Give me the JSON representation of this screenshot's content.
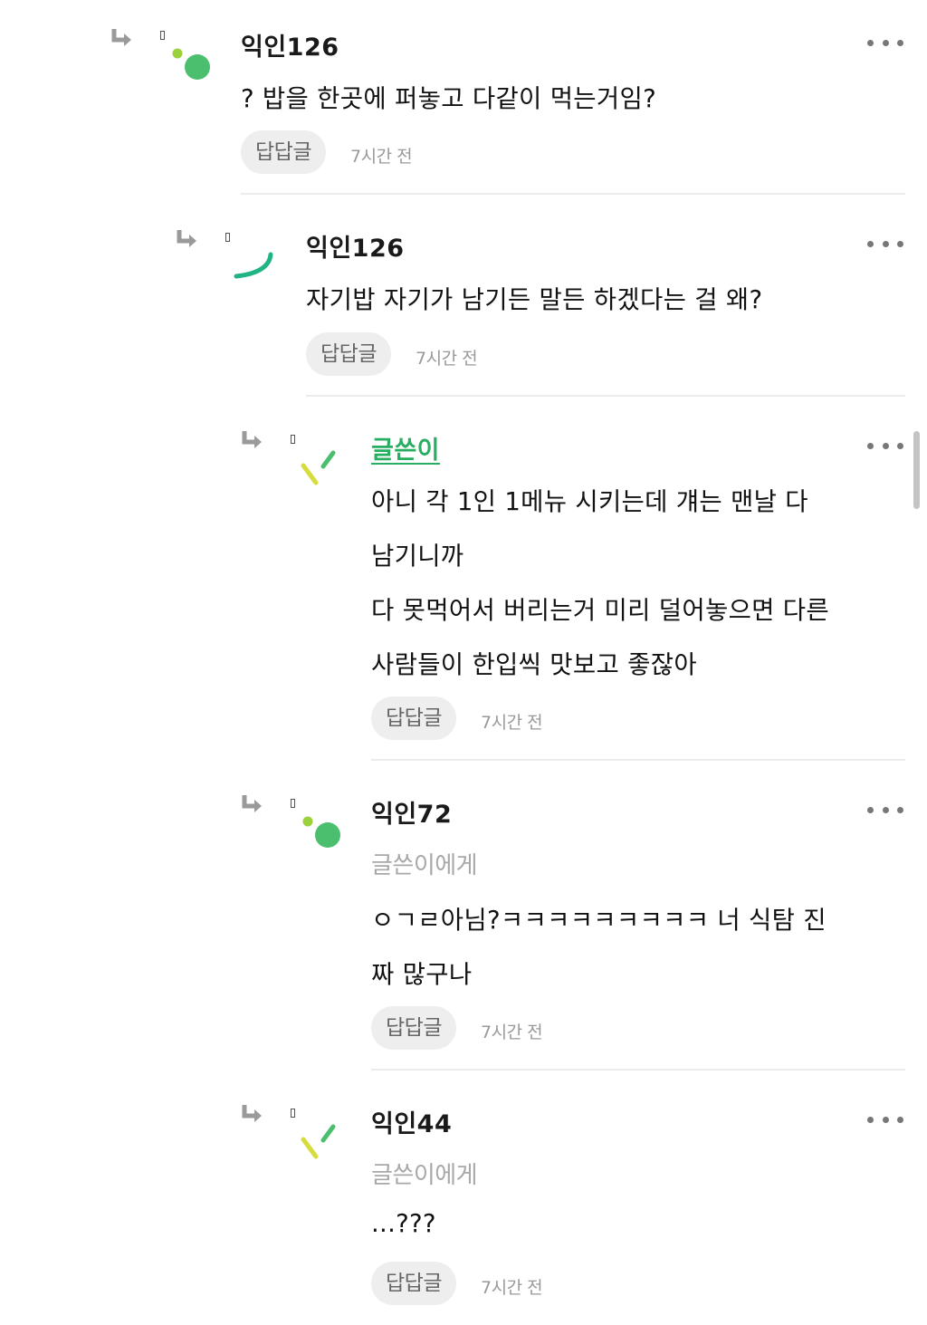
{
  "comments": [
    {
      "author": "익인126",
      "is_op": false,
      "target": "",
      "lines": [
        "? 밥을 한곳에 퍼놓고 다같이 먹는거임?"
      ],
      "reply_label": "답답글",
      "time": "7시간 전",
      "avatar_icon": "dots-avatar-icon"
    },
    {
      "author": "익인126",
      "is_op": false,
      "target": "",
      "lines": [
        "자기밥 자기가 남기든 말든 하겠다는 걸 왜?"
      ],
      "reply_label": "답답글",
      "time": "7시간 전",
      "avatar_icon": "arc-avatar-icon"
    },
    {
      "author": "글쓴이",
      "is_op": true,
      "target": "",
      "lines": [
        "아니 각 1인 1메뉴 시키는데 걔는 맨날 다",
        "남기니까",
        "다 못먹어서 버리는거 미리 덜어놓으면 다른",
        "사람들이 한입씩 맛보고 좋잖아"
      ],
      "reply_label": "답답글",
      "time": "7시간 전",
      "avatar_icon": "slashes-avatar-icon"
    },
    {
      "author": "익인72",
      "is_op": false,
      "target": "글쓴이에게",
      "lines": [
        "ㅇㄱㄹ아님?ㅋㅋㅋㅋㅋㅋㅋㅋㅋ 너 식탐 진",
        "짜 많구나"
      ],
      "reply_label": "답답글",
      "time": "7시간 전",
      "avatar_icon": "dots-avatar-icon"
    },
    {
      "author": "익인44",
      "is_op": false,
      "target": "글쓴이에게",
      "lines": [
        "...???"
      ],
      "reply_label": "답답글",
      "time": "7시간 전",
      "avatar_icon": "slashes-avatar-icon"
    }
  ],
  "colors": {
    "op_author": "#27ae60",
    "avatar_green": "#4cbf6e",
    "avatar_lime": "#9bd13a",
    "avatar_teal": "#1fb386",
    "avatar_yellow": "#d6dc3c",
    "reply_button_bg": "#eeeeee"
  }
}
